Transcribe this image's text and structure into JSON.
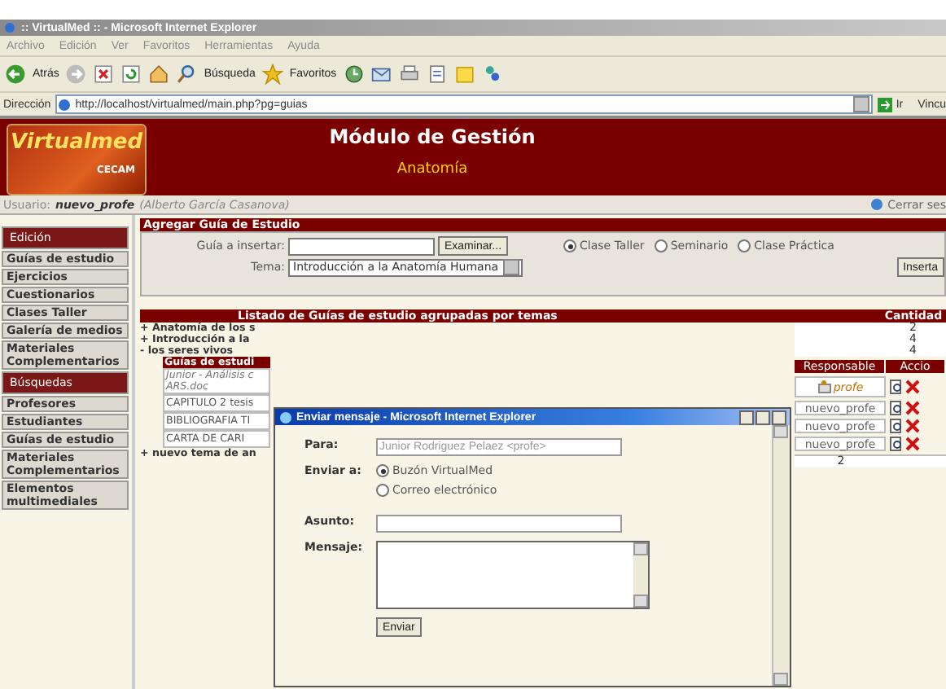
{
  "browser": {
    "title": ":: VirtualMed :: - Microsoft Internet Explorer",
    "menu": [
      "Archivo",
      "Edición",
      "Ver",
      "Favoritos",
      "Herramientas",
      "Ayuda"
    ],
    "toolbar": [
      "Atrás",
      "Búsqueda",
      "Favoritos"
    ],
    "address_label": "Dirección",
    "address": "http://localhost/virtualmed/main.php?pg=guias",
    "go": "Ir",
    "links": "Vincu"
  },
  "header": {
    "logo": "Virtualmed",
    "logo_sub": "CECAM",
    "title": "Módulo de Gestión",
    "subject": "Anatomía"
  },
  "user_bar": {
    "label": "Usuario:",
    "user": "nuevo_profe",
    "name": "(Alberto García Casanova)",
    "logout": "Cerrar ses"
  },
  "sidebar": [
    {
      "kind": "header",
      "label": "Edición"
    },
    {
      "kind": "link",
      "label": "Guías de estudio"
    },
    {
      "kind": "link",
      "label": "Ejercicios"
    },
    {
      "kind": "link",
      "label": "Cuestionarios"
    },
    {
      "kind": "link",
      "label": "Clases Taller"
    },
    {
      "kind": "link",
      "label": "Galería de medios"
    },
    {
      "kind": "link",
      "label": "Materiales Complementarios"
    },
    {
      "kind": "header",
      "label": "Búsquedas"
    },
    {
      "kind": "link",
      "label": "Profesores"
    },
    {
      "kind": "link",
      "label": "Estudiantes"
    },
    {
      "kind": "link",
      "label": "Guías de estudio"
    },
    {
      "kind": "link",
      "label": "Materiales Complementarios"
    },
    {
      "kind": "link",
      "label": "Elementos multimediales"
    }
  ],
  "add_guide": {
    "title": "Agregar Guía de Estudio",
    "file_label": "Guía a insertar:",
    "browse": "Examinar...",
    "topic_label": "Tema:",
    "topic": "Introducción a la Anatomía Humana",
    "types": [
      {
        "label": "Clase Taller",
        "selected": true
      },
      {
        "label": "Seminario",
        "selected": false
      },
      {
        "label": "Clase Práctica",
        "selected": false
      }
    ],
    "insert": "Inserta"
  },
  "listing": {
    "title": "Listado de Guías de estudio agrupadas por temas",
    "count_header": "Cantidad",
    "topics": [
      {
        "marker": "+",
        "label": "Anatomía de los s",
        "count": "2"
      },
      {
        "marker": "+",
        "label": "Introducción a la",
        "count": "4"
      },
      {
        "marker": "-",
        "label": "los seres vivos",
        "count": "4"
      }
    ],
    "guides_header": "Guías de estudi",
    "guides_columns": [
      "Responsable",
      "Accio"
    ],
    "guides": [
      {
        "kind": "highlight",
        "title_lines": [
          "Junior - Análisis c",
          "ARS.doc"
        ],
        "owner": "profe"
      },
      {
        "kind": "plain",
        "title_lines": [
          "CAPITULO 2 tesis"
        ],
        "owner": "nuevo_profe"
      },
      {
        "kind": "plain",
        "title_lines": [
          "BIBLIOGRAFIA TI"
        ],
        "owner": "nuevo_profe"
      },
      {
        "kind": "plain",
        "title_lines": [
          "CARTA DE CARI"
        ],
        "owner": "nuevo_profe"
      }
    ],
    "guides_count": "2",
    "new_topic": {
      "marker": "+",
      "label": "nuevo tema de an"
    }
  },
  "popup": {
    "title": "Enviar mensaje - Microsoft Internet Explorer",
    "to_label": "Para:",
    "to": "Junior Rodriguez Pelaez <profe>",
    "send_to_label": "Enviar a:",
    "send_options": [
      {
        "label": "Buzón VirtualMed",
        "selected": true
      },
      {
        "label": "Correo electrónico",
        "selected": false
      }
    ],
    "subject_label": "Asunto:",
    "message_label": "Mensaje:",
    "send": "Enviar"
  }
}
